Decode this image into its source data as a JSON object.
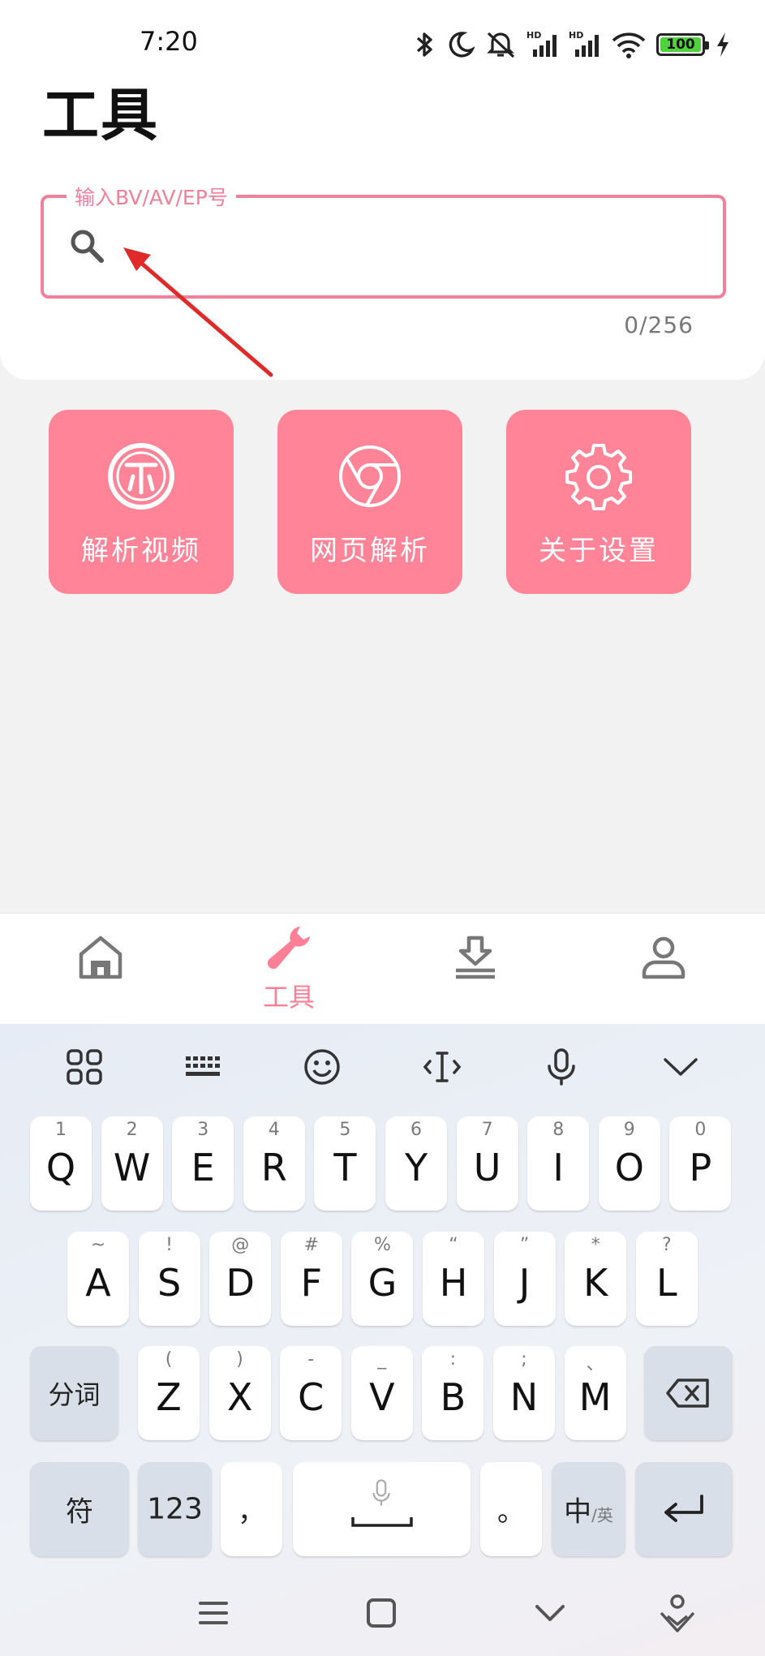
{
  "status": {
    "time": "7:20",
    "battery": "100",
    "icons": [
      "bluetooth-icon",
      "moon-icon",
      "mute-icon",
      "signal-hd-icon",
      "signal-hd-icon",
      "wifi-icon",
      "battery-icon",
      "charging-icon"
    ]
  },
  "header": {
    "title": "工具"
  },
  "search": {
    "legend": "输入BV/AV/EP号",
    "value": "",
    "counter": "0/256"
  },
  "tiles": [
    {
      "label": "解析视频",
      "icon": "parse-video-icon"
    },
    {
      "label": "网页解析",
      "icon": "browser-icon"
    },
    {
      "label": "关于设置",
      "icon": "gear-icon"
    }
  ],
  "nav": {
    "items": [
      {
        "icon": "home-icon",
        "label": ""
      },
      {
        "icon": "wrench-icon",
        "label": "工具",
        "active": true
      },
      {
        "icon": "download-icon",
        "label": ""
      },
      {
        "icon": "user-icon",
        "label": ""
      }
    ],
    "accent": "#ff7f96"
  },
  "keyboard": {
    "toolbar": [
      "apps-grid-icon",
      "keyboard-icon",
      "emoji-icon",
      "cursor-icon",
      "microphone-icon",
      "chevron-down-icon"
    ],
    "row1": [
      {
        "main": "Q",
        "sub": "1"
      },
      {
        "main": "W",
        "sub": "2"
      },
      {
        "main": "E",
        "sub": "3"
      },
      {
        "main": "R",
        "sub": "4"
      },
      {
        "main": "T",
        "sub": "5"
      },
      {
        "main": "Y",
        "sub": "6"
      },
      {
        "main": "U",
        "sub": "7"
      },
      {
        "main": "I",
        "sub": "8"
      },
      {
        "main": "O",
        "sub": "9"
      },
      {
        "main": "P",
        "sub": "0"
      }
    ],
    "row2": [
      {
        "main": "A",
        "sub": "~"
      },
      {
        "main": "S",
        "sub": "!"
      },
      {
        "main": "D",
        "sub": "@"
      },
      {
        "main": "F",
        "sub": "#"
      },
      {
        "main": "G",
        "sub": "%"
      },
      {
        "main": "H",
        "sub": "“"
      },
      {
        "main": "J",
        "sub": "”"
      },
      {
        "main": "K",
        "sub": "*"
      },
      {
        "main": "L",
        "sub": "?"
      }
    ],
    "row3": [
      {
        "main": "Z",
        "sub": "("
      },
      {
        "main": "X",
        "sub": ")"
      },
      {
        "main": "C",
        "sub": "-"
      },
      {
        "main": "V",
        "sub": "_"
      },
      {
        "main": "B",
        "sub": ":"
      },
      {
        "main": "N",
        "sub": ";"
      },
      {
        "main": "M",
        "sub": "、"
      }
    ],
    "fenci": "分词",
    "symbols": "符",
    "numbers": "123",
    "comma": "，",
    "period": "。",
    "lang_main": "中",
    "lang_sub": "/英"
  },
  "system_nav": [
    "menu-icon",
    "home-square-icon",
    "back-chevron-icon",
    "assistant-icon"
  ]
}
